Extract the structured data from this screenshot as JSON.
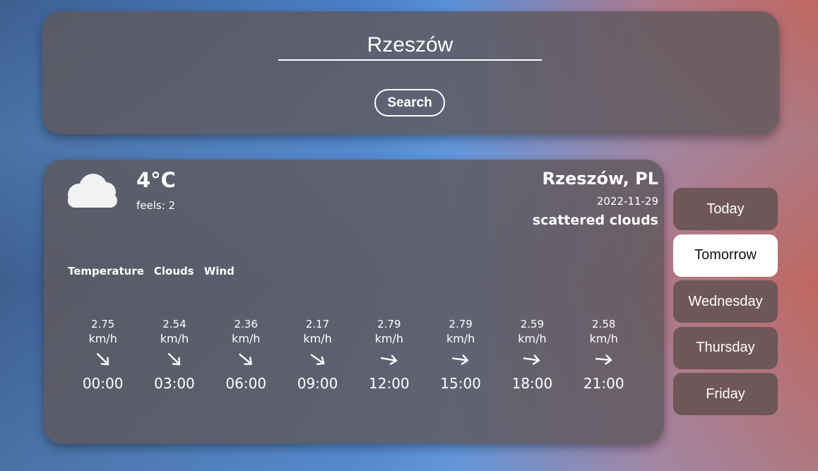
{
  "search": {
    "value": "Rzeszów",
    "button_label": "Search"
  },
  "current": {
    "icon": "cloud-icon",
    "temperature": "4°C",
    "feels": "feels: 2",
    "city": "Rzeszów, PL",
    "date": "2022-11-29",
    "description": "scattered clouds"
  },
  "tabs": [
    "Temperature",
    "Clouds",
    "Wind"
  ],
  "forecast": [
    {
      "speed": "2.75",
      "unit": "km/h",
      "direction_deg": 45,
      "time": "00:00"
    },
    {
      "speed": "2.54",
      "unit": "km/h",
      "direction_deg": 45,
      "time": "03:00"
    },
    {
      "speed": "2.36",
      "unit": "km/h",
      "direction_deg": 40,
      "time": "06:00"
    },
    {
      "speed": "2.17",
      "unit": "km/h",
      "direction_deg": 35,
      "time": "09:00"
    },
    {
      "speed": "2.79",
      "unit": "km/h",
      "direction_deg": 10,
      "time": "12:00"
    },
    {
      "speed": "2.79",
      "unit": "km/h",
      "direction_deg": 8,
      "time": "15:00"
    },
    {
      "speed": "2.59",
      "unit": "km/h",
      "direction_deg": 8,
      "time": "18:00"
    },
    {
      "speed": "2.58",
      "unit": "km/h",
      "direction_deg": 5,
      "time": "21:00"
    }
  ],
  "days": [
    {
      "label": "Today",
      "active": false
    },
    {
      "label": "Tomorrow",
      "active": true
    },
    {
      "label": "Wednesday",
      "active": false
    },
    {
      "label": "Thursday",
      "active": false
    },
    {
      "label": "Friday",
      "active": false
    }
  ],
  "colors": {
    "panel": "#5f585c",
    "day_button": "#6e5758",
    "active_day": "#ffffff"
  }
}
